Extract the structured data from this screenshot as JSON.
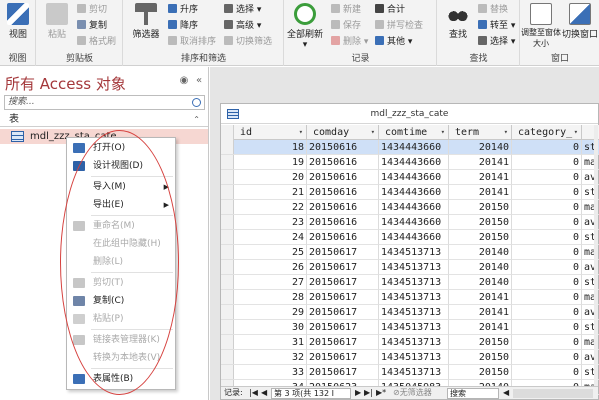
{
  "ribbon": {
    "groups": [
      {
        "title": "视图",
        "items": [
          "视图"
        ]
      },
      {
        "title": "剪贴板",
        "items": [
          "粘贴",
          "剪切",
          "复制",
          "格式刷"
        ]
      },
      {
        "title": "排序和筛选",
        "items": [
          "筛选器",
          "升序",
          "降序",
          "取消排序",
          "选择",
          "高级",
          "切换筛选"
        ]
      },
      {
        "title": "记录",
        "items": [
          "全部刷新",
          "新建",
          "保存",
          "删除",
          "合计",
          "拼写检查",
          "其他"
        ]
      },
      {
        "title": "查找",
        "items": [
          "查找",
          "替换",
          "转至",
          "选择"
        ]
      },
      {
        "title": "窗口",
        "items": [
          "调整至窗体大小",
          "切换窗口"
        ]
      }
    ]
  },
  "nav": {
    "title": "所有 Access 对象",
    "search_placeholder": "搜索...",
    "section": "表",
    "item": "mdl_zzz_sta_cate"
  },
  "context_menu": [
    {
      "label": "打开(O)",
      "enabled": true,
      "icon": "open-icon"
    },
    {
      "label": "设计视图(D)",
      "enabled": true,
      "icon": "design-view-icon"
    },
    {
      "label": "导入(M)",
      "enabled": true,
      "submenu": true
    },
    {
      "label": "导出(E)",
      "enabled": true,
      "submenu": true
    },
    {
      "label": "重命名(M)",
      "enabled": false,
      "icon": "rename-icon"
    },
    {
      "label": "在此组中隐藏(H)",
      "enabled": false
    },
    {
      "label": "删除(L)",
      "enabled": false
    },
    {
      "label": "剪切(T)",
      "enabled": false,
      "icon": "cut-icon"
    },
    {
      "label": "复制(C)",
      "enabled": true,
      "icon": "copy-icon"
    },
    {
      "label": "粘贴(P)",
      "enabled": false,
      "icon": "paste-icon"
    },
    {
      "label": "链接表管理器(K)",
      "enabled": false,
      "icon": "link-manager-icon"
    },
    {
      "label": "转换为本地表(V)",
      "enabled": false
    },
    {
      "label": "表属性(B)",
      "enabled": true,
      "icon": "properties-icon"
    }
  ],
  "table": {
    "title": "mdl_zzz_sta_cate",
    "columns": [
      "id",
      "comday",
      "comtime",
      "term",
      "category_"
    ],
    "rows": [
      [
        "18",
        "20150616",
        "1434443660",
        "20140",
        "0",
        "st"
      ],
      [
        "19",
        "20150616",
        "1434443660",
        "20141",
        "0",
        "ma"
      ],
      [
        "20",
        "20150616",
        "1434443660",
        "20141",
        "0",
        "av"
      ],
      [
        "21",
        "20150616",
        "1434443660",
        "20141",
        "0",
        "st"
      ],
      [
        "22",
        "20150616",
        "1434443660",
        "20150",
        "0",
        "ma"
      ],
      [
        "23",
        "20150616",
        "1434443660",
        "20150",
        "0",
        "av"
      ],
      [
        "24",
        "20150616",
        "1434443660",
        "20150",
        "0",
        "st"
      ],
      [
        "25",
        "20150617",
        "1434513713",
        "20140",
        "0",
        "ma"
      ],
      [
        "26",
        "20150617",
        "1434513713",
        "20140",
        "0",
        "av"
      ],
      [
        "27",
        "20150617",
        "1434513713",
        "20140",
        "0",
        "st"
      ],
      [
        "28",
        "20150617",
        "1434513713",
        "20141",
        "0",
        "ma"
      ],
      [
        "29",
        "20150617",
        "1434513713",
        "20141",
        "0",
        "av"
      ],
      [
        "30",
        "20150617",
        "1434513713",
        "20141",
        "0",
        "st"
      ],
      [
        "31",
        "20150617",
        "1434513713",
        "20150",
        "0",
        "ma"
      ],
      [
        "32",
        "20150617",
        "1434513713",
        "20150",
        "0",
        "av"
      ],
      [
        "33",
        "20150617",
        "1434513713",
        "20150",
        "0",
        "st"
      ],
      [
        "34",
        "20150623",
        "1435045983",
        "20140",
        "0",
        "ma"
      ]
    ]
  },
  "record_bar": {
    "label": "记录:",
    "position": "第 3 项(共 132 I",
    "filter": "无筛选器",
    "search": "搜索"
  },
  "colors": {
    "nav_title": "#a4373a",
    "selected_row": "#cfe0f7",
    "nav_selected": "#f6d7d2",
    "annotation": "#d6423f"
  }
}
